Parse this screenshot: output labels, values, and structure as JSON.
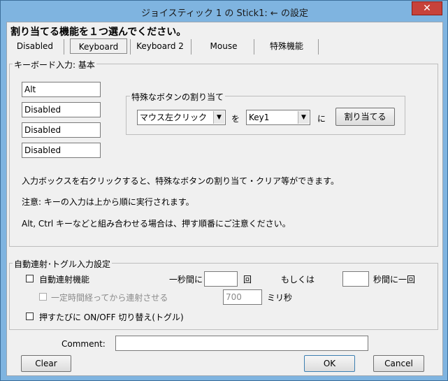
{
  "window": {
    "title": "ジョイスティック 1 の Stick1: ← の設定",
    "close": "✕"
  },
  "heading": "割り当てる機能を１つ選んでください。",
  "tabs": [
    "Disabled",
    "Keyboard",
    "Keyboard 2",
    "Mouse",
    "特殊機能"
  ],
  "keyboard_group": {
    "label": "キーボード入力: 基本",
    "inputs": [
      "Alt",
      "Disabled",
      "Disabled",
      "Disabled"
    ],
    "special": {
      "label": "特殊なボタンの割り当て",
      "button_select": "マウス左クリック",
      "wo": "を",
      "key_select": "Key1",
      "ni": "に",
      "assign_button": "割り当てる"
    },
    "notes": [
      "入力ボックスを右クリックすると、特殊なボタンの割り当て・クリア等ができます。",
      "注意: キーの入力は上から順に実行されます。",
      "Alt, Ctrl キーなどと組み合わせる場合は、押す順番にご注意ください。"
    ]
  },
  "auto_group": {
    "label": "自動連射･トグル入力設定",
    "auto_fire": "自動連射機能",
    "per_second": "一秒間に",
    "times": "回",
    "or": "もしくは",
    "per_seconds_once": "秒間に一回",
    "delay_label": "一定時間経ってから連射させる",
    "delay_value": "700",
    "ms": "ミリ秒",
    "toggle": "押すたびに ON/OFF 切り替え(トグル)"
  },
  "comment_label": "Comment:",
  "buttons": {
    "clear": "Clear",
    "ok": "OK",
    "cancel": "Cancel"
  }
}
